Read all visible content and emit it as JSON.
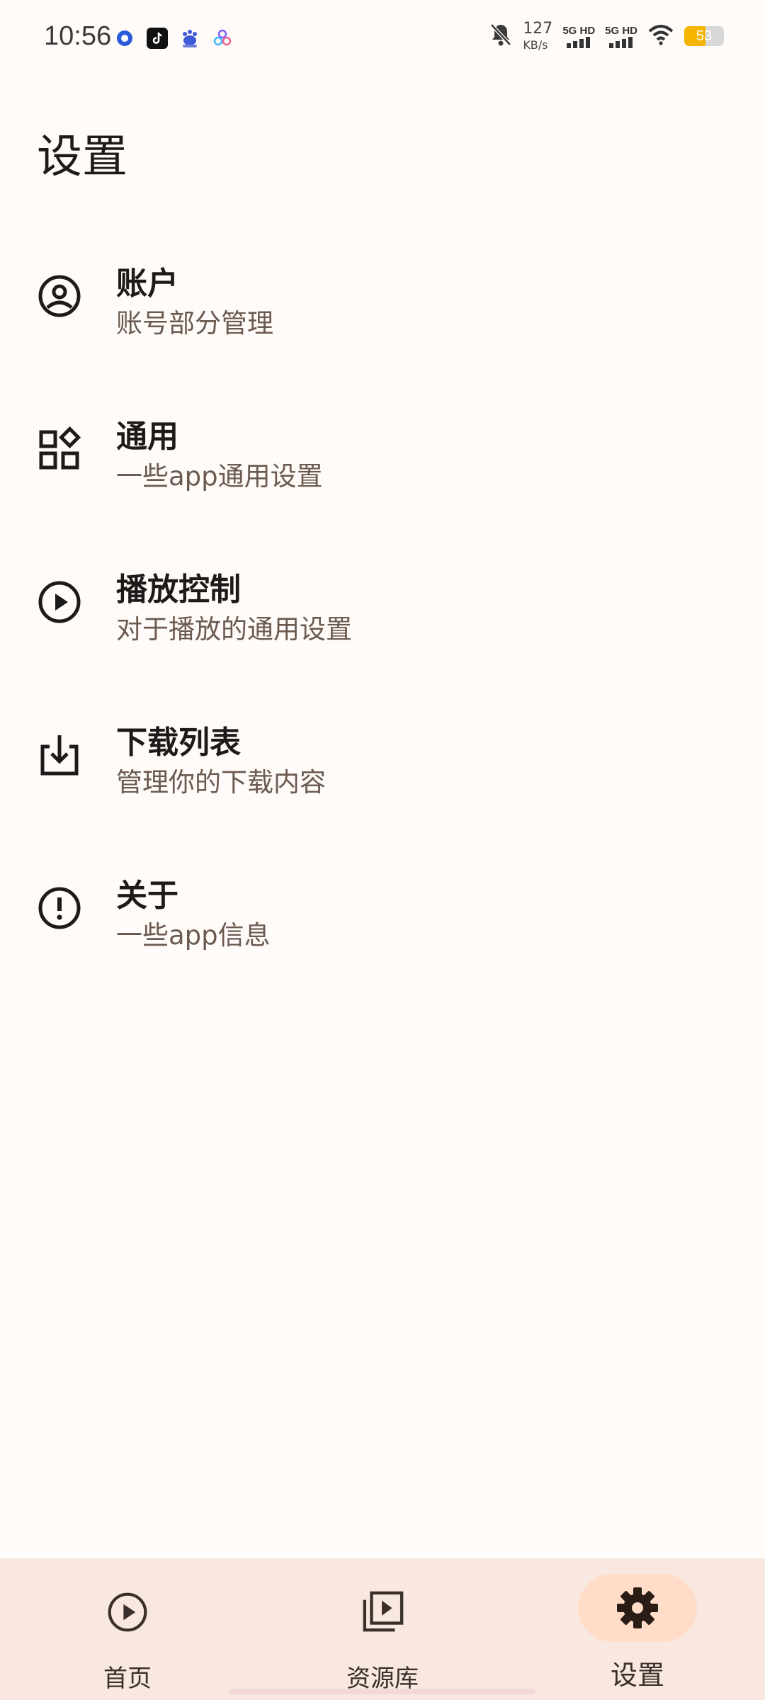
{
  "status_bar": {
    "time": "10:56",
    "net_speed_value": "127",
    "net_speed_unit": "KB/s",
    "sim1_label": "5G HD",
    "sim2_label": "5G HD",
    "battery": "53",
    "battery_level": 0.53,
    "battery_color": "#F4B400"
  },
  "page": {
    "title": "设置"
  },
  "settings": {
    "items": [
      {
        "icon": "account-circle-icon",
        "title": "账户",
        "subtitle": "账号部分管理"
      },
      {
        "icon": "widgets-icon",
        "title": "通用",
        "subtitle": "一些app通用设置"
      },
      {
        "icon": "play-circle-icon",
        "title": "播放控制",
        "subtitle": "对于播放的通用设置"
      },
      {
        "icon": "download-icon",
        "title": "下载列表",
        "subtitle": "管理你的下载内容"
      },
      {
        "icon": "info-icon",
        "title": "关于",
        "subtitle": "一些app信息"
      }
    ]
  },
  "bottom_nav": {
    "items": [
      {
        "icon": "play-circle-icon",
        "label": "首页",
        "active": false
      },
      {
        "icon": "video-library-icon",
        "label": "资源库",
        "active": false
      },
      {
        "icon": "gear-icon",
        "label": "设置",
        "active": true
      }
    ]
  },
  "colors": {
    "background": "#FFFBF9",
    "nav_background": "#F8E8DF",
    "active_pill": "#FFDDC8",
    "subtitle": "#6b5a50"
  }
}
